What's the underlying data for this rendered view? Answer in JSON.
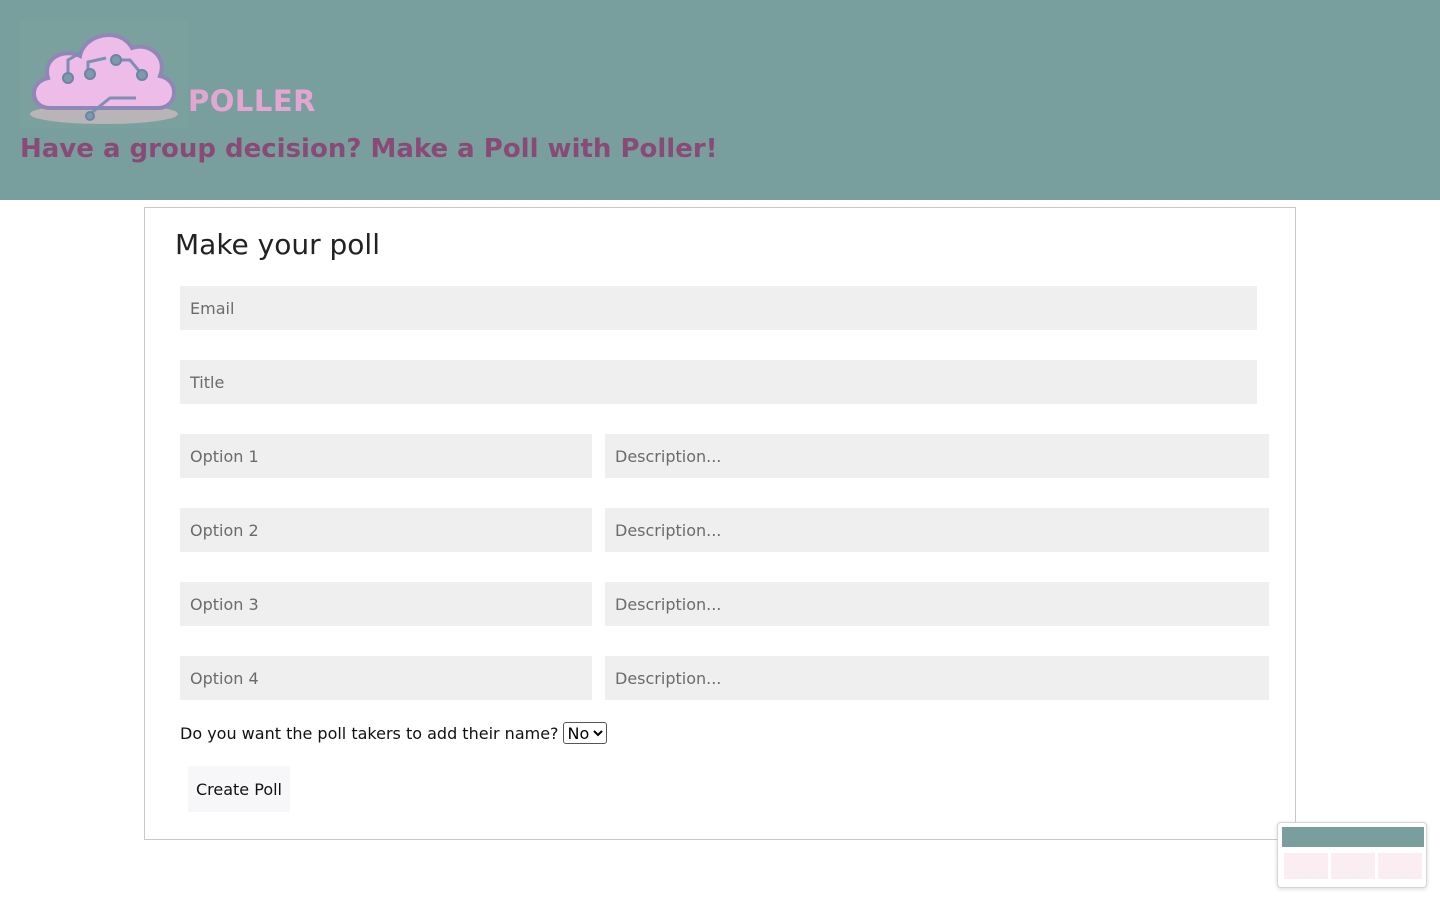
{
  "header": {
    "brand": "POLLER",
    "tagline": "Have a group decision? Make a Poll with Poller!",
    "logo_icon": "cloud-circuit-logo"
  },
  "form": {
    "title": "Make your poll",
    "email_placeholder": "Email",
    "title_placeholder": "Title",
    "options": [
      {
        "placeholder": "Option 1",
        "description_placeholder": "Description..."
      },
      {
        "placeholder": "Option 2",
        "description_placeholder": "Description..."
      },
      {
        "placeholder": "Option 3",
        "description_placeholder": "Description..."
      },
      {
        "placeholder": "Option 4",
        "description_placeholder": "Description..."
      }
    ],
    "name_question": "Do you want the poll takers to add their name?",
    "name_select_value": "No",
    "submit_label": "Create Poll"
  },
  "colors": {
    "header_bg": "#789f9d",
    "brand": "#e3a6d3",
    "tagline": "#8a4a78",
    "field_bg": "#efefef"
  }
}
